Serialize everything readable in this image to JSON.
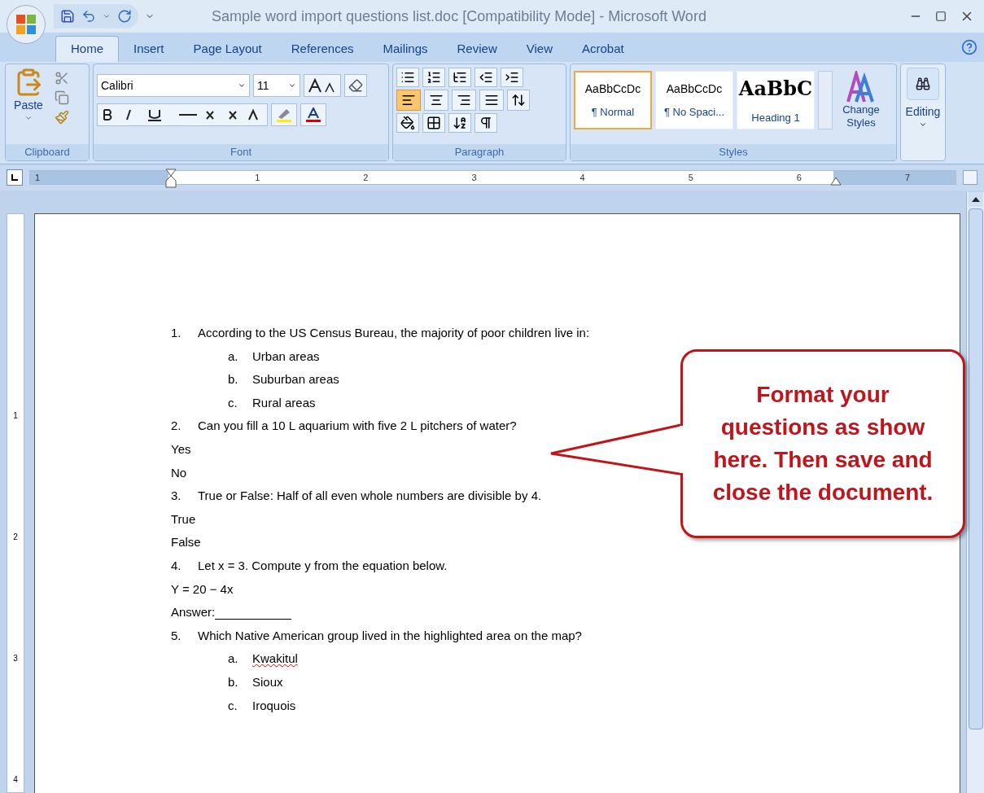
{
  "window": {
    "title": "Sample word import questions list.doc [Compatibility Mode] - Microsoft Word"
  },
  "tabs": [
    {
      "label": "Home",
      "selected": true
    },
    {
      "label": "Insert",
      "selected": false
    },
    {
      "label": "Page Layout",
      "selected": false
    },
    {
      "label": "References",
      "selected": false
    },
    {
      "label": "Mailings",
      "selected": false
    },
    {
      "label": "Review",
      "selected": false
    },
    {
      "label": "View",
      "selected": false
    },
    {
      "label": "Acrobat",
      "selected": false
    }
  ],
  "ribbon": {
    "clipboard": {
      "label": "Clipboard",
      "paste": "Paste"
    },
    "font": {
      "label": "Font",
      "font_name": "Calibri",
      "font_size": "11"
    },
    "paragraph": {
      "label": "Paragraph",
      "alignments": [
        {
          "kind": "left",
          "selected": true
        },
        {
          "kind": "center",
          "selected": false
        },
        {
          "kind": "right",
          "selected": false
        },
        {
          "kind": "justify",
          "selected": false
        }
      ]
    },
    "styles": {
      "label": "Styles",
      "items": [
        {
          "sample": "AaBbCcDc",
          "name": "¶ Normal",
          "selected": true,
          "kind": "normal"
        },
        {
          "sample": "AaBbCcDc",
          "name": "¶ No Spaci...",
          "selected": false,
          "kind": "normal"
        },
        {
          "sample": "AaBbC",
          "name": "Heading 1",
          "selected": false,
          "kind": "heading"
        }
      ],
      "change_styles": "Change Styles"
    },
    "editing": {
      "label": "Editing"
    }
  },
  "ruler": {
    "numbers": [
      "1",
      "1",
      "2",
      "3",
      "4",
      "5",
      "6",
      "7"
    ]
  },
  "vertical_ruler": {
    "numbers": [
      "1",
      "2",
      "3",
      "4"
    ]
  },
  "document": {
    "lines": [
      {
        "kind": "numbered",
        "marker": "1.",
        "text": "According to the US Census Bureau, the majority of poor children live in:"
      },
      {
        "kind": "lettered",
        "marker": "a.",
        "text": "Urban areas"
      },
      {
        "kind": "lettered",
        "marker": "b.",
        "text": "Suburban areas"
      },
      {
        "kind": "lettered",
        "marker": "c.",
        "text": "Rural areas"
      },
      {
        "kind": "numbered",
        "marker": "2.",
        "text": "Can you fill a 10 L aquarium with five 2 L pitchers of water?"
      },
      {
        "kind": "plain",
        "text": "Yes"
      },
      {
        "kind": "plain",
        "text": "No"
      },
      {
        "kind": "numbered",
        "marker": "3.",
        "text": "True or False: Half of all even whole numbers are divisible by 4."
      },
      {
        "kind": "plain",
        "text": "True"
      },
      {
        "kind": "plain",
        "text": "False"
      },
      {
        "kind": "numbered",
        "marker": "4.",
        "text": "Let x = 3. Compute y from the equation below."
      },
      {
        "kind": "plain",
        "text": "Y = 20 − 4x"
      },
      {
        "kind": "answer",
        "text": "Answer:"
      },
      {
        "kind": "numbered",
        "marker": "5.",
        "text": "Which Native American group lived in the highlighted area on the map?"
      },
      {
        "kind": "lettered",
        "marker": "a.",
        "text": "Kwakitul",
        "misspelled": true
      },
      {
        "kind": "lettered",
        "marker": "b.",
        "text": "Sioux"
      },
      {
        "kind": "lettered",
        "marker": "c.",
        "text": "Iroquois"
      }
    ]
  },
  "callout": {
    "text": "Format your questions as show here. Then save and close the document."
  }
}
